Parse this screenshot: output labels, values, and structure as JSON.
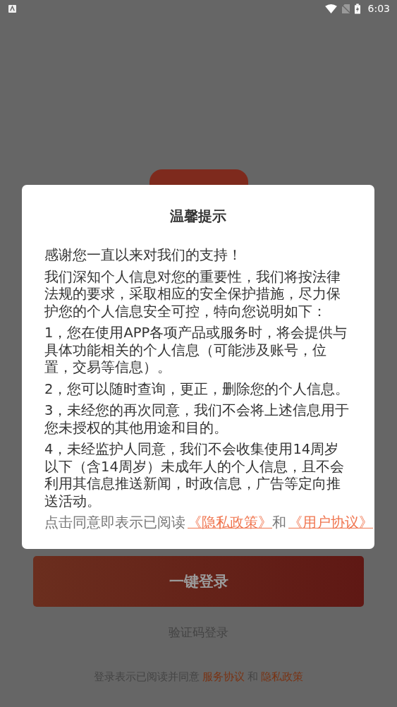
{
  "status_bar": {
    "time": "6:03"
  },
  "login_screen": {
    "login_button": "一键登录",
    "sms_login": "验证码登录",
    "footer": {
      "prefix": "登录表示已阅读并同意",
      "links": [
        "服务协议",
        "隐私政策"
      ],
      "joiner": "和"
    }
  },
  "dialog": {
    "title": "温馨提示",
    "paragraphs": [
      "感谢您一直以来对我们的支持！",
      "我们深知个人信息对您的重要性，我们将按法律法规的要求，采取相应的安全保护措施，尽力保护您的个人信息安全可控，特向您说明如下：",
      "1，您在使用APP各项产品或服务时，将会提供与具体功能相关的个人信息（可能涉及账号，位置，交易等信息）。",
      "2，您可以随时查询，更正，删除您的个人信息。",
      "3，未经您的再次同意，我们不会将上述信息用于您未授权的其他用途和目的。",
      "4，未经监护人同意，我们不会收集使用14周岁以下（含14周岁）未成年人的个人信息，且不会利用其信息推送新闻，时政信息，广告等定向推送活动。"
    ],
    "consent": {
      "prefix": "点击同意即表示已阅读",
      "links": [
        "《隐私政策》",
        "《用户协议》"
      ],
      "joiner": "和"
    }
  }
}
